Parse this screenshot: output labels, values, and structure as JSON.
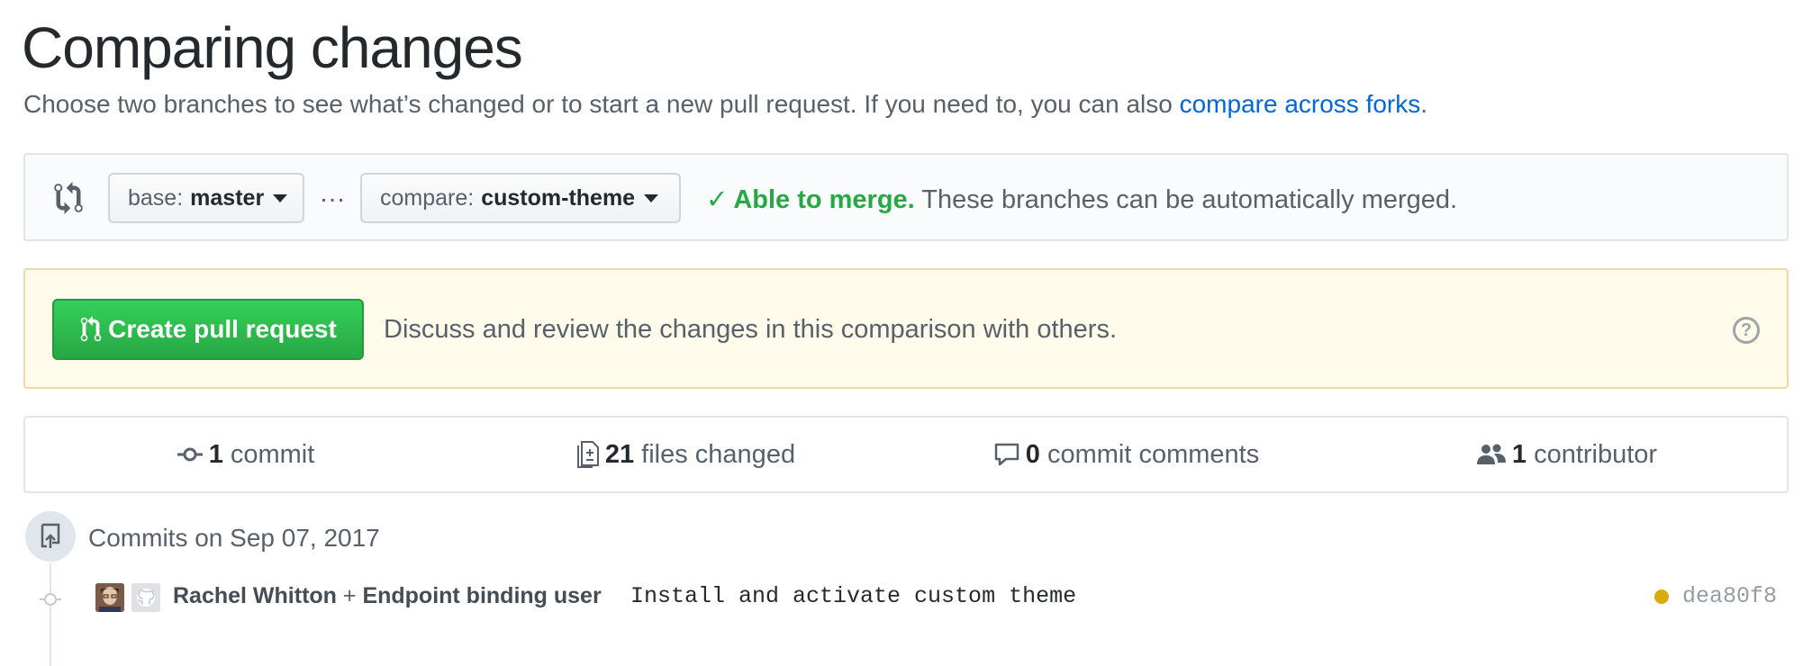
{
  "header": {
    "title": "Comparing changes",
    "subtitle_text": "Choose two branches to see what’s changed or to start a new pull request. If you need to, you can also ",
    "subtitle_link": "compare across forks",
    "subtitle_end": "."
  },
  "range": {
    "base_label": "base:",
    "base_branch": "master",
    "ellipsis": "…",
    "compare_label": "compare:",
    "compare_branch": "custom-theme",
    "merge_ok": "Able to merge.",
    "merge_text": " These branches can be automatically merged."
  },
  "pull_request": {
    "button_label": "Create pull request",
    "description": "Discuss and review the changes in this comparison with others.",
    "help_glyph": "?"
  },
  "summary": {
    "commits_count": "1",
    "commits_label": "commit",
    "files_count": "21",
    "files_label": "files changed",
    "comments_count": "0",
    "comments_label": "commit comments",
    "contributors_count": "1",
    "contributors_label": "contributor"
  },
  "commits": {
    "group_title": "Commits on Sep 07, 2017",
    "items": [
      {
        "author_1": "Rachel Whitton",
        "joiner": " + ",
        "author_2": "Endpoint binding user",
        "message": "Install and activate custom theme",
        "sha": "dea80f8",
        "status_color": "#dbab09"
      }
    ]
  },
  "colors": {
    "link": "#0366d6",
    "success": "#28a745",
    "warning_bg": "#fffbea",
    "pending": "#dbab09"
  },
  "icons": [
    "git-compare-icon",
    "chevron-down-icon",
    "check-icon",
    "git-pull-request-icon",
    "question-icon",
    "git-commit-icon",
    "diff-icon",
    "comment-icon",
    "people-icon",
    "repo-push-icon",
    "avatar",
    "github-mark-icon"
  ]
}
